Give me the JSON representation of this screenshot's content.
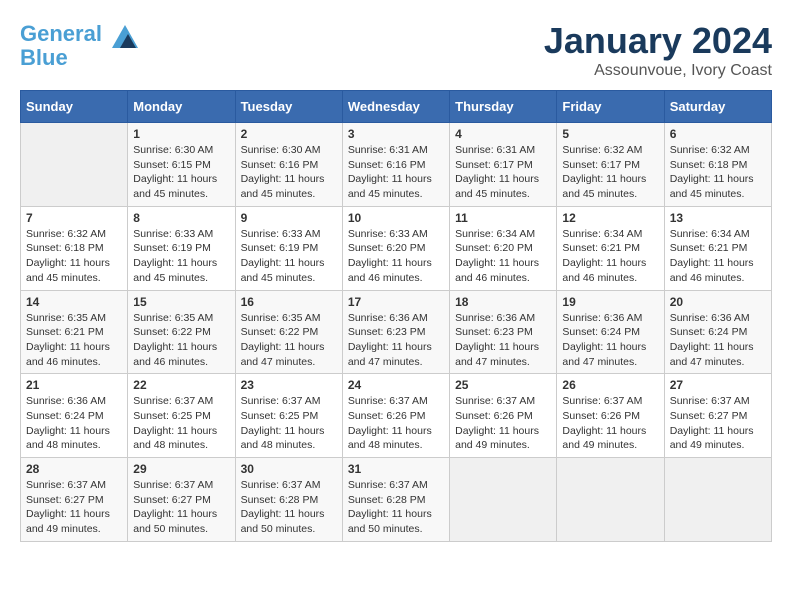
{
  "logo": {
    "line1": "General",
    "line2": "Blue"
  },
  "title": "January 2024",
  "subtitle": "Assounvoue, Ivory Coast",
  "header_color": "#3a6baf",
  "weekdays": [
    "Sunday",
    "Monday",
    "Tuesday",
    "Wednesday",
    "Thursday",
    "Friday",
    "Saturday"
  ],
  "weeks": [
    [
      {
        "day": "",
        "sunrise": "",
        "sunset": "",
        "daylight": ""
      },
      {
        "day": "1",
        "sunrise": "Sunrise: 6:30 AM",
        "sunset": "Sunset: 6:15 PM",
        "daylight": "Daylight: 11 hours and 45 minutes."
      },
      {
        "day": "2",
        "sunrise": "Sunrise: 6:30 AM",
        "sunset": "Sunset: 6:16 PM",
        "daylight": "Daylight: 11 hours and 45 minutes."
      },
      {
        "day": "3",
        "sunrise": "Sunrise: 6:31 AM",
        "sunset": "Sunset: 6:16 PM",
        "daylight": "Daylight: 11 hours and 45 minutes."
      },
      {
        "day": "4",
        "sunrise": "Sunrise: 6:31 AM",
        "sunset": "Sunset: 6:17 PM",
        "daylight": "Daylight: 11 hours and 45 minutes."
      },
      {
        "day": "5",
        "sunrise": "Sunrise: 6:32 AM",
        "sunset": "Sunset: 6:17 PM",
        "daylight": "Daylight: 11 hours and 45 minutes."
      },
      {
        "day": "6",
        "sunrise": "Sunrise: 6:32 AM",
        "sunset": "Sunset: 6:18 PM",
        "daylight": "Daylight: 11 hours and 45 minutes."
      }
    ],
    [
      {
        "day": "7",
        "sunrise": "Sunrise: 6:32 AM",
        "sunset": "Sunset: 6:18 PM",
        "daylight": "Daylight: 11 hours and 45 minutes."
      },
      {
        "day": "8",
        "sunrise": "Sunrise: 6:33 AM",
        "sunset": "Sunset: 6:19 PM",
        "daylight": "Daylight: 11 hours and 45 minutes."
      },
      {
        "day": "9",
        "sunrise": "Sunrise: 6:33 AM",
        "sunset": "Sunset: 6:19 PM",
        "daylight": "Daylight: 11 hours and 45 minutes."
      },
      {
        "day": "10",
        "sunrise": "Sunrise: 6:33 AM",
        "sunset": "Sunset: 6:20 PM",
        "daylight": "Daylight: 11 hours and 46 minutes."
      },
      {
        "day": "11",
        "sunrise": "Sunrise: 6:34 AM",
        "sunset": "Sunset: 6:20 PM",
        "daylight": "Daylight: 11 hours and 46 minutes."
      },
      {
        "day": "12",
        "sunrise": "Sunrise: 6:34 AM",
        "sunset": "Sunset: 6:21 PM",
        "daylight": "Daylight: 11 hours and 46 minutes."
      },
      {
        "day": "13",
        "sunrise": "Sunrise: 6:34 AM",
        "sunset": "Sunset: 6:21 PM",
        "daylight": "Daylight: 11 hours and 46 minutes."
      }
    ],
    [
      {
        "day": "14",
        "sunrise": "Sunrise: 6:35 AM",
        "sunset": "Sunset: 6:21 PM",
        "daylight": "Daylight: 11 hours and 46 minutes."
      },
      {
        "day": "15",
        "sunrise": "Sunrise: 6:35 AM",
        "sunset": "Sunset: 6:22 PM",
        "daylight": "Daylight: 11 hours and 46 minutes."
      },
      {
        "day": "16",
        "sunrise": "Sunrise: 6:35 AM",
        "sunset": "Sunset: 6:22 PM",
        "daylight": "Daylight: 11 hours and 47 minutes."
      },
      {
        "day": "17",
        "sunrise": "Sunrise: 6:36 AM",
        "sunset": "Sunset: 6:23 PM",
        "daylight": "Daylight: 11 hours and 47 minutes."
      },
      {
        "day": "18",
        "sunrise": "Sunrise: 6:36 AM",
        "sunset": "Sunset: 6:23 PM",
        "daylight": "Daylight: 11 hours and 47 minutes."
      },
      {
        "day": "19",
        "sunrise": "Sunrise: 6:36 AM",
        "sunset": "Sunset: 6:24 PM",
        "daylight": "Daylight: 11 hours and 47 minutes."
      },
      {
        "day": "20",
        "sunrise": "Sunrise: 6:36 AM",
        "sunset": "Sunset: 6:24 PM",
        "daylight": "Daylight: 11 hours and 47 minutes."
      }
    ],
    [
      {
        "day": "21",
        "sunrise": "Sunrise: 6:36 AM",
        "sunset": "Sunset: 6:24 PM",
        "daylight": "Daylight: 11 hours and 48 minutes."
      },
      {
        "day": "22",
        "sunrise": "Sunrise: 6:37 AM",
        "sunset": "Sunset: 6:25 PM",
        "daylight": "Daylight: 11 hours and 48 minutes."
      },
      {
        "day": "23",
        "sunrise": "Sunrise: 6:37 AM",
        "sunset": "Sunset: 6:25 PM",
        "daylight": "Daylight: 11 hours and 48 minutes."
      },
      {
        "day": "24",
        "sunrise": "Sunrise: 6:37 AM",
        "sunset": "Sunset: 6:26 PM",
        "daylight": "Daylight: 11 hours and 48 minutes."
      },
      {
        "day": "25",
        "sunrise": "Sunrise: 6:37 AM",
        "sunset": "Sunset: 6:26 PM",
        "daylight": "Daylight: 11 hours and 49 minutes."
      },
      {
        "day": "26",
        "sunrise": "Sunrise: 6:37 AM",
        "sunset": "Sunset: 6:26 PM",
        "daylight": "Daylight: 11 hours and 49 minutes."
      },
      {
        "day": "27",
        "sunrise": "Sunrise: 6:37 AM",
        "sunset": "Sunset: 6:27 PM",
        "daylight": "Daylight: 11 hours and 49 minutes."
      }
    ],
    [
      {
        "day": "28",
        "sunrise": "Sunrise: 6:37 AM",
        "sunset": "Sunset: 6:27 PM",
        "daylight": "Daylight: 11 hours and 49 minutes."
      },
      {
        "day": "29",
        "sunrise": "Sunrise: 6:37 AM",
        "sunset": "Sunset: 6:27 PM",
        "daylight": "Daylight: 11 hours and 50 minutes."
      },
      {
        "day": "30",
        "sunrise": "Sunrise: 6:37 AM",
        "sunset": "Sunset: 6:28 PM",
        "daylight": "Daylight: 11 hours and 50 minutes."
      },
      {
        "day": "31",
        "sunrise": "Sunrise: 6:37 AM",
        "sunset": "Sunset: 6:28 PM",
        "daylight": "Daylight: 11 hours and 50 minutes."
      },
      {
        "day": "",
        "sunrise": "",
        "sunset": "",
        "daylight": ""
      },
      {
        "day": "",
        "sunrise": "",
        "sunset": "",
        "daylight": ""
      },
      {
        "day": "",
        "sunrise": "",
        "sunset": "",
        "daylight": ""
      }
    ]
  ]
}
